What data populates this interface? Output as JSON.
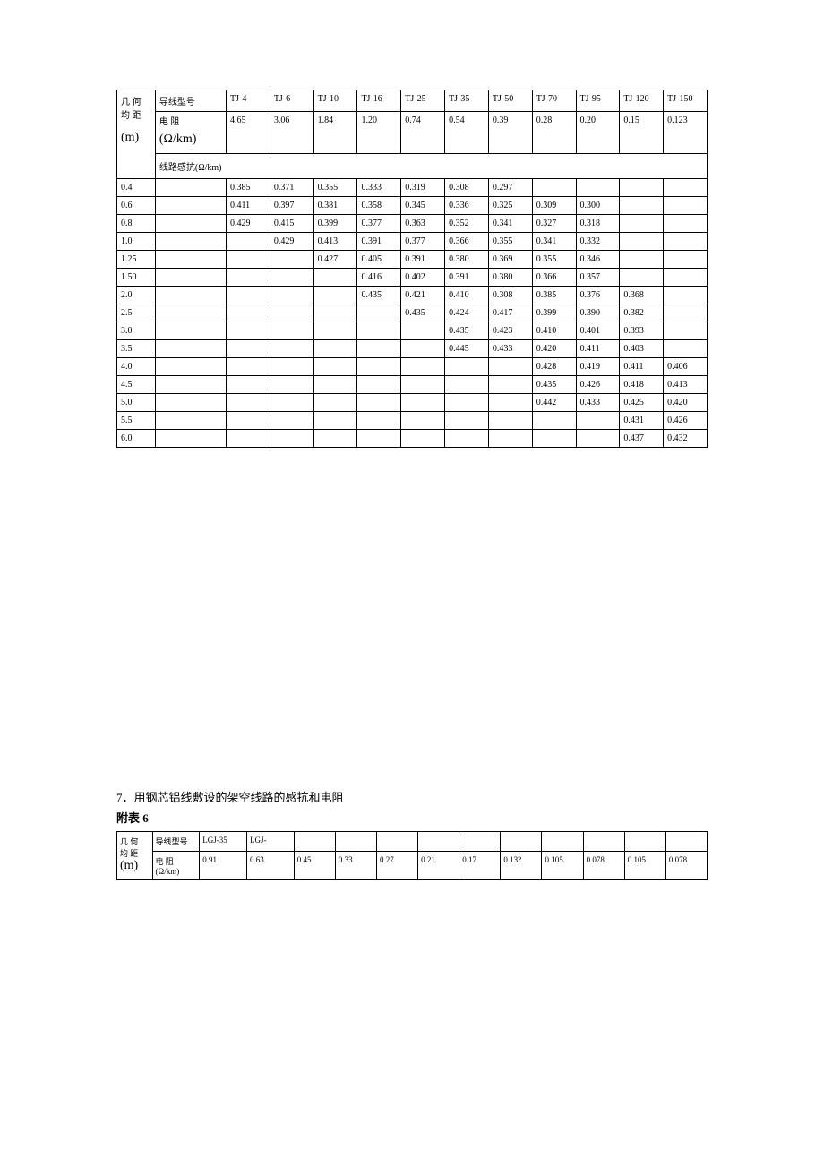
{
  "table1": {
    "rowlabel": "几 何",
    "rowlabel2": "均 距",
    "rowlabel_unit": "(m)",
    "header_model": "导线型号",
    "header_resist": "电     阻",
    "header_resist_unit": "(Ω/km)",
    "models": [
      "TJ-4",
      "TJ-6",
      "TJ-10",
      "TJ-16",
      "TJ-25",
      "TJ-35",
      "TJ-50",
      "TJ-70",
      "TJ-95",
      "TJ-120",
      "TJ-150"
    ],
    "resist": [
      "4.65",
      "3.06",
      "1.84",
      "1.20",
      "0.74",
      "0.54",
      "0.39",
      "0.28",
      "0.20",
      "0.15",
      "0.123"
    ],
    "reactance_label": "线路感抗(Ω/km)",
    "rows": [
      {
        "d": "0.4",
        "v": [
          "0.385",
          "0.371",
          "0.355",
          "0.333",
          "0.319",
          "0.308",
          "0.297",
          "",
          "",
          "",
          ""
        ]
      },
      {
        "d": "0.6",
        "v": [
          "0.411",
          "0.397",
          "0.381",
          "0.358",
          "0.345",
          "0.336",
          "0.325",
          "0.309",
          "0.300",
          "",
          ""
        ]
      },
      {
        "d": "0.8",
        "v": [
          "0.429",
          "0.415",
          "0.399",
          "0.377",
          "0.363",
          "0.352",
          "0.341",
          "0.327",
          "0.318",
          "",
          ""
        ]
      },
      {
        "d": "1.0",
        "v": [
          "",
          "0.429",
          "0.413",
          "0.391",
          "0.377",
          "0.366",
          "0.355",
          "0.341",
          "0.332",
          "",
          ""
        ]
      },
      {
        "d": "1.25",
        "v": [
          "",
          "",
          "0.427",
          "0.405",
          "0.391",
          "0.380",
          "0.369",
          "0.355",
          "0.346",
          "",
          ""
        ]
      },
      {
        "d": "1.50",
        "v": [
          "",
          "",
          "",
          "0.416",
          "0.402",
          "0.391",
          "0.380",
          "0.366",
          "0.357",
          "",
          ""
        ]
      },
      {
        "d": "2.0",
        "v": [
          "",
          "",
          "",
          "0.435",
          "0.421",
          "0.410",
          "0.308",
          "0.385",
          "0.376",
          "0.368",
          ""
        ]
      },
      {
        "d": "2.5",
        "v": [
          "",
          "",
          "",
          "",
          "0.435",
          "0.424",
          "0.417",
          "0.399",
          "0.390",
          "0.382",
          ""
        ]
      },
      {
        "d": "3.0",
        "v": [
          "",
          "",
          "",
          "",
          "",
          "0.435",
          "0.423",
          "0.410",
          "0.401",
          "0.393",
          ""
        ]
      },
      {
        "d": "3.5",
        "v": [
          "",
          "",
          "",
          "",
          "",
          "0.445",
          "0.433",
          "0.420",
          "0.411",
          "0.403",
          ""
        ]
      },
      {
        "d": "4.0",
        "v": [
          "",
          "",
          "",
          "",
          "",
          "",
          "",
          "0.428",
          "0.419",
          "0.411",
          "0.406"
        ]
      },
      {
        "d": "4.5",
        "v": [
          "",
          "",
          "",
          "",
          "",
          "",
          "",
          "0.435",
          "0.426",
          "0.418",
          "0.413"
        ]
      },
      {
        "d": "5.0",
        "v": [
          "",
          "",
          "",
          "",
          "",
          "",
          "",
          "0.442",
          "0.433",
          "0.425",
          "0.420"
        ]
      },
      {
        "d": "5.5",
        "v": [
          "",
          "",
          "",
          "",
          "",
          "",
          "",
          "",
          "",
          "0.431",
          "0.426"
        ]
      },
      {
        "d": "6.0",
        "v": [
          "",
          "",
          "",
          "",
          "",
          "",
          "",
          "",
          "",
          "0.437",
          "0.432"
        ]
      }
    ]
  },
  "section7": {
    "title": "7．用钢芯铝线敷设的架空线路的感抗和电阻",
    "appendix": "附表 6"
  },
  "table2": {
    "rowlabel": "几 何",
    "rowlabel2": "均 距",
    "rowlabel_unit": "(m)",
    "header_model": "导线型号",
    "header_resist": "电  阻",
    "header_resist_unit": "(Ω/km)",
    "models": [
      "LGJ-35",
      "LGJ-",
      "",
      "",
      "",
      "",
      "",
      "",
      "",
      "",
      "",
      ""
    ],
    "resist": [
      "0.91",
      "0.63",
      "0.45",
      "0.33",
      "0.27",
      "0.21",
      "0.17",
      "0.13?",
      "0.105",
      "0.078",
      "0.105",
      "0.078"
    ]
  }
}
